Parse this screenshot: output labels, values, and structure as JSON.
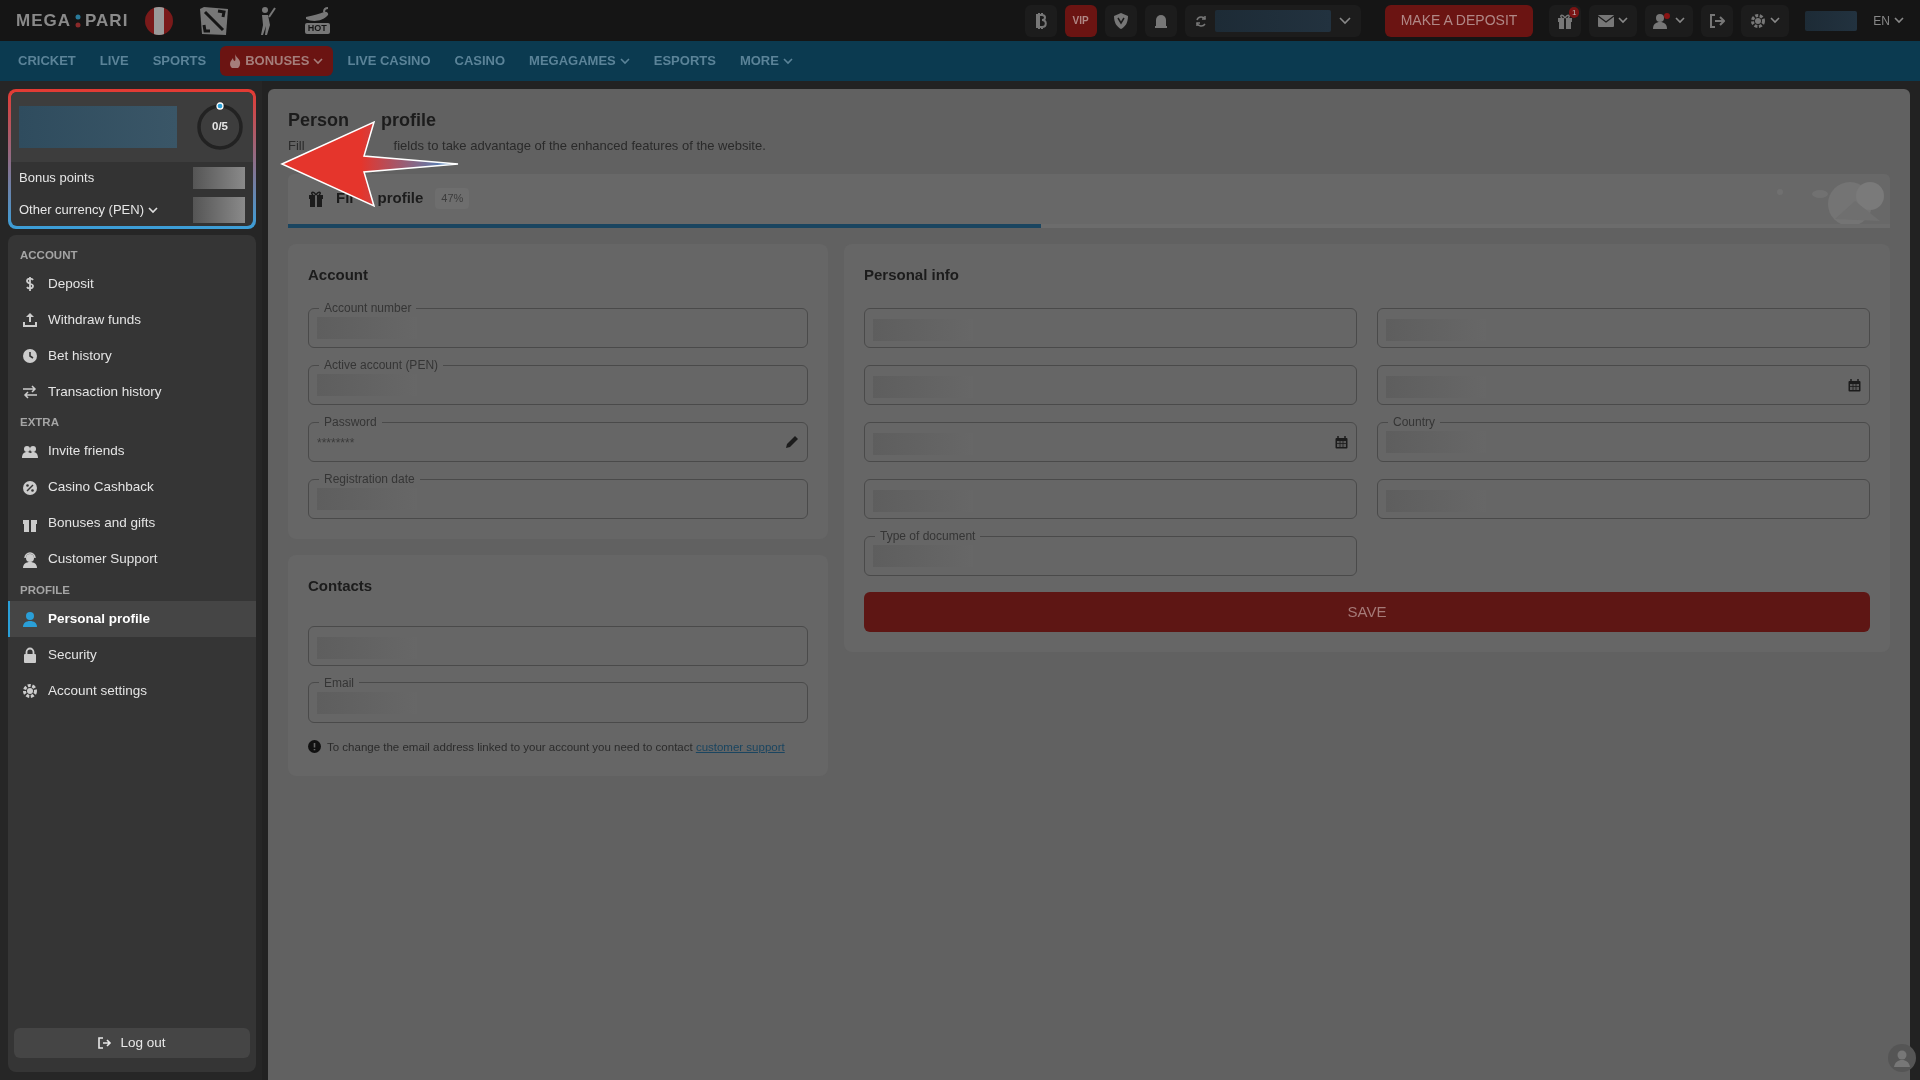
{
  "header": {
    "logo": [
      "MEGA",
      "PARI"
    ],
    "hot_label": "HOT",
    "vip_label": "VIP",
    "deposit_button": "MAKE A DEPOSIT",
    "gift_count": "1",
    "language": "EN"
  },
  "nav": [
    {
      "label": "CRICKET",
      "selected": false,
      "dropdown": false
    },
    {
      "label": "LIVE",
      "selected": false,
      "dropdown": false
    },
    {
      "label": "SPORTS",
      "selected": false,
      "dropdown": false
    },
    {
      "label": "BONUSES",
      "selected": true,
      "dropdown": true
    },
    {
      "label": "LIVE CASINO",
      "selected": false,
      "dropdown": false
    },
    {
      "label": "CASINO",
      "selected": false,
      "dropdown": false
    },
    {
      "label": "MEGAGAMES",
      "selected": false,
      "dropdown": true
    },
    {
      "label": "ESPORTS",
      "selected": false,
      "dropdown": false
    },
    {
      "label": "MORE",
      "selected": false,
      "dropdown": true
    }
  ],
  "bonus_panel": {
    "progress": "0/5",
    "level": 0,
    "rows": [
      {
        "label": "Bonus points",
        "dropdown": false
      },
      {
        "label": "Other currency (PEN)",
        "dropdown": true
      }
    ]
  },
  "sidebar": {
    "sections": [
      {
        "title": "ACCOUNT",
        "items": [
          {
            "label": "Deposit",
            "selected": false
          },
          {
            "label": "Withdraw funds",
            "selected": false
          },
          {
            "label": "Bet history",
            "selected": false
          },
          {
            "label": "Transaction history",
            "selected": false
          }
        ]
      },
      {
        "title": "EXTRA",
        "items": [
          {
            "label": "Invite friends",
            "selected": false
          },
          {
            "label": "Casino Cashback",
            "selected": false
          },
          {
            "label": "Bonuses and gifts",
            "selected": false
          },
          {
            "label": "Customer Support",
            "selected": false
          }
        ]
      },
      {
        "title": "PROFILE",
        "items": [
          {
            "label": "Personal profile",
            "selected": true
          },
          {
            "label": "Security",
            "selected": false
          },
          {
            "label": "Account settings",
            "selected": false
          }
        ]
      }
    ],
    "logout": "Log out"
  },
  "page": {
    "title": [
      "Person",
      "profile"
    ],
    "subtitle": [
      "Fill",
      "fields to take advantage of the enhanced features of the website."
    ],
    "fill_label": [
      "Fil",
      "profile"
    ],
    "fill_percent": "47%",
    "level": 0.47
  },
  "account": {
    "title": "Account",
    "fields": [
      {
        "label": "Account number",
        "masked": true
      },
      {
        "label": "Active account (PEN)",
        "masked": true
      },
      {
        "label": "Password",
        "kind": "password",
        "value": "********",
        "masked": false
      },
      {
        "label": "Registration date",
        "masked": true
      }
    ]
  },
  "contacts": {
    "title": "Contacts",
    "fields": [
      {
        "masked": true
      },
      {
        "label": "Email",
        "masked": true
      }
    ],
    "note": "To change the email address linked to your account you need to contact",
    "note_link": "customer support"
  },
  "personal_info": {
    "title": "Personal info",
    "fields": [
      {
        "masked": true
      },
      {
        "masked": true
      },
      {
        "masked": true
      },
      {
        "kind": "date",
        "masked": true
      },
      {
        "kind": "date",
        "masked": true
      },
      {
        "label": "Country",
        "masked": true
      },
      {
        "masked": true
      },
      {
        "masked": true
      },
      {
        "label": "Type of document",
        "masked": true
      }
    ],
    "save_button": "SAVE"
  }
}
